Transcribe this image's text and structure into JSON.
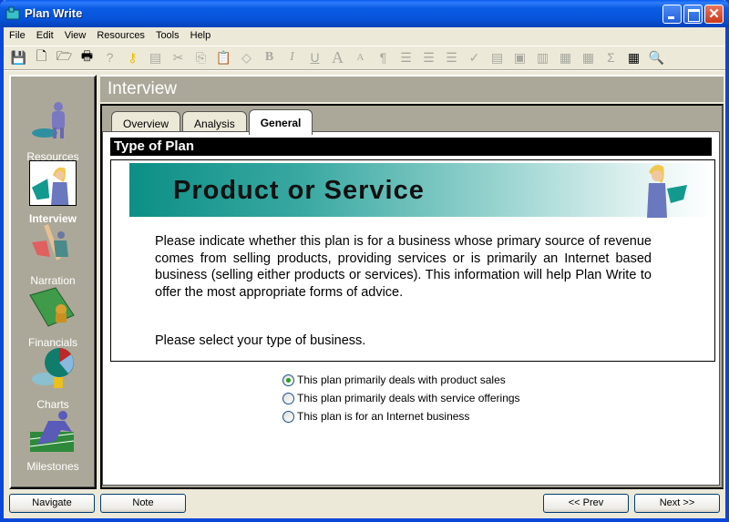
{
  "window": {
    "title": "Plan Write",
    "controls": [
      "minimize",
      "maximize",
      "close"
    ]
  },
  "menu": [
    "File",
    "Edit",
    "View",
    "Resources",
    "Tools",
    "Help"
  ],
  "toolbar": [
    {
      "icon": "save-icon",
      "enabled": true
    },
    {
      "icon": "new-document-icon",
      "enabled": true
    },
    {
      "icon": "open-folder-icon",
      "enabled": true
    },
    {
      "icon": "print-icon",
      "enabled": true
    },
    {
      "icon": "help-icon",
      "enabled": false
    },
    {
      "icon": "key-icon",
      "enabled": true
    },
    {
      "icon": "caption-icon",
      "enabled": false
    },
    {
      "icon": "cut-icon",
      "enabled": false
    },
    {
      "icon": "copy-icon",
      "enabled": false
    },
    {
      "icon": "paste-icon",
      "enabled": false
    },
    {
      "icon": "eraser-icon",
      "enabled": false
    },
    {
      "icon": "bold-icon",
      "enabled": false
    },
    {
      "icon": "italic-icon",
      "enabled": false
    },
    {
      "icon": "underline-icon",
      "enabled": false
    },
    {
      "icon": "grow-font-icon",
      "enabled": false
    },
    {
      "icon": "shrink-font-icon",
      "enabled": false
    },
    {
      "icon": "paragraph-icon",
      "enabled": false
    },
    {
      "icon": "align-left-icon",
      "enabled": false
    },
    {
      "icon": "align-center-icon",
      "enabled": false
    },
    {
      "icon": "align-right-icon",
      "enabled": false
    },
    {
      "icon": "spellcheck-icon",
      "enabled": false
    },
    {
      "icon": "text-block-icon",
      "enabled": false
    },
    {
      "icon": "text-frame-icon",
      "enabled": false
    },
    {
      "icon": "chart-icon",
      "enabled": false
    },
    {
      "icon": "document-table-icon",
      "enabled": false
    },
    {
      "icon": "grid-icon",
      "enabled": false
    },
    {
      "icon": "sum-icon",
      "enabled": false
    },
    {
      "icon": "spreadsheet-icon",
      "enabled": true
    },
    {
      "icon": "magnifier-icon",
      "enabled": true
    }
  ],
  "sidebar": {
    "items": [
      {
        "label": "Resources",
        "active": false
      },
      {
        "label": "Interview",
        "active": true
      },
      {
        "label": "Narration",
        "active": false
      },
      {
        "label": "Financials",
        "active": false
      },
      {
        "label": "Charts",
        "active": false
      },
      {
        "label": "Milestones",
        "active": false
      }
    ]
  },
  "main": {
    "section_title": "Interview",
    "tabs": [
      {
        "label": "Overview",
        "active": false
      },
      {
        "label": "Analysis",
        "active": false
      },
      {
        "label": "General",
        "active": true
      }
    ],
    "type_of_plan_header": "Type of Plan",
    "banner_title": "Product or Service",
    "description": "Please indicate whether this plan is for a business whose primary source of revenue comes from selling products, providing services or is primarily an Internet based business (selling either products or services). This information will help Plan Write to offer the most appropriate forms of advice.",
    "prompt": "Please select your type of business.",
    "options": [
      {
        "label": "This plan primarily deals with product sales",
        "checked": true
      },
      {
        "label": "This plan primarily deals with service offerings",
        "checked": false
      },
      {
        "label": "This plan is for an Internet business",
        "checked": false
      }
    ]
  },
  "footer": {
    "navigate": "Navigate",
    "note": "Note",
    "prev": "<< Prev",
    "next": "Next >>"
  }
}
